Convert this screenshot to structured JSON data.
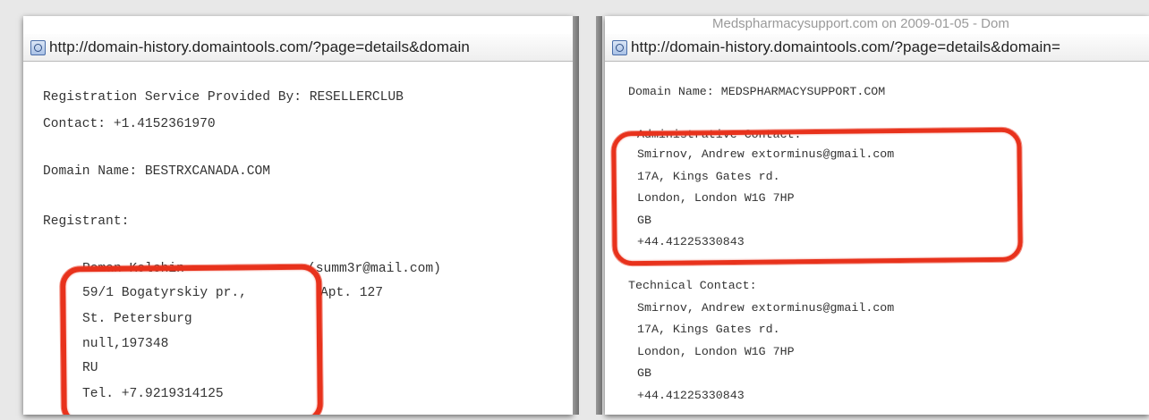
{
  "left_window": {
    "url": "http://domain-history.domaintools.com/?page=details&domain",
    "lines": [
      "Registration Service Provided By: RESELLERCLUB",
      "Contact: +1.4152361970",
      "Domain Name: BESTRXCANADA.COM",
      "Registrant:",
      "Roman Kolchin",
      "(summ3r@mail.com)",
      "59/1 Bogatyrskiy pr.,",
      "Apt. 127",
      "St. Petersburg",
      "null,197348",
      "RU",
      "Tel. +7.9219314125"
    ]
  },
  "right_window": {
    "frame_title": "Medspharmacysupport.com on 2009-01-05 - Dom",
    "url": "http://domain-history.domaintools.com/?page=details&domain=",
    "lines": [
      "Domain Name: MEDSPHARMACYSUPPORT.COM",
      "Administrative Contact:",
      "Smirnov, Andrew extorminus@gmail.com",
      "17A, Kings Gates rd.",
      "London, London W1G 7HP",
      "GB",
      "+44.41225330843",
      "Technical Contact:",
      "Smirnov, Andrew extorminus@gmail.com",
      "17A, Kings Gates rd.",
      "London, London W1G 7HP",
      "GB",
      "+44.41225330843"
    ]
  },
  "colors": {
    "highlight_red": "#e8321c",
    "text": "#333333"
  }
}
